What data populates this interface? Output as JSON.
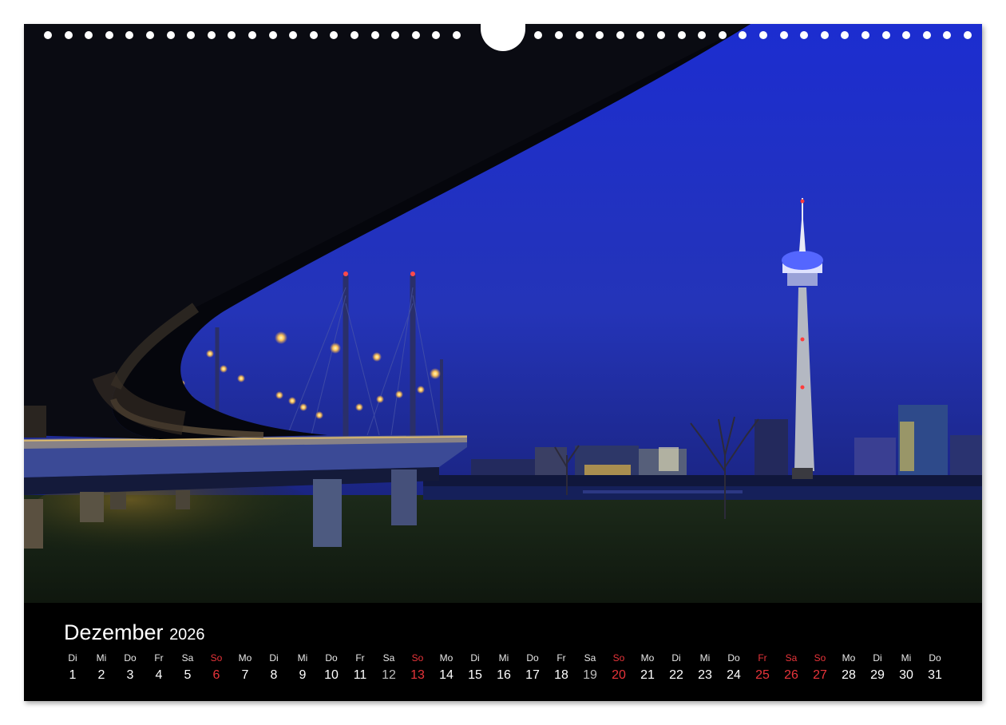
{
  "calendar": {
    "month": "Dezember",
    "year": "2026",
    "days": [
      {
        "wd": "Di",
        "num": "1",
        "type": "weekday"
      },
      {
        "wd": "Mi",
        "num": "2",
        "type": "weekday"
      },
      {
        "wd": "Do",
        "num": "3",
        "type": "weekday"
      },
      {
        "wd": "Fr",
        "num": "4",
        "type": "weekday"
      },
      {
        "wd": "Sa",
        "num": "5",
        "type": "weekday"
      },
      {
        "wd": "So",
        "num": "6",
        "type": "sun"
      },
      {
        "wd": "Mo",
        "num": "7",
        "type": "weekday"
      },
      {
        "wd": "Di",
        "num": "8",
        "type": "weekday"
      },
      {
        "wd": "Mi",
        "num": "9",
        "type": "weekday"
      },
      {
        "wd": "Do",
        "num": "10",
        "type": "weekday"
      },
      {
        "wd": "Fr",
        "num": "11",
        "type": "weekday"
      },
      {
        "wd": "Sa",
        "num": "12",
        "type": "sat"
      },
      {
        "wd": "So",
        "num": "13",
        "type": "sun"
      },
      {
        "wd": "Mo",
        "num": "14",
        "type": "weekday"
      },
      {
        "wd": "Di",
        "num": "15",
        "type": "weekday"
      },
      {
        "wd": "Mi",
        "num": "16",
        "type": "weekday"
      },
      {
        "wd": "Do",
        "num": "17",
        "type": "weekday"
      },
      {
        "wd": "Fr",
        "num": "18",
        "type": "weekday"
      },
      {
        "wd": "Sa",
        "num": "19",
        "type": "sat"
      },
      {
        "wd": "So",
        "num": "20",
        "type": "sun"
      },
      {
        "wd": "Mo",
        "num": "21",
        "type": "weekday"
      },
      {
        "wd": "Di",
        "num": "22",
        "type": "weekday"
      },
      {
        "wd": "Mi",
        "num": "23",
        "type": "weekday"
      },
      {
        "wd": "Do",
        "num": "24",
        "type": "weekday"
      },
      {
        "wd": "Fr",
        "num": "25",
        "type": "hol"
      },
      {
        "wd": "Sa",
        "num": "26",
        "type": "hol"
      },
      {
        "wd": "So",
        "num": "27",
        "type": "sun"
      },
      {
        "wd": "Mo",
        "num": "28",
        "type": "weekday"
      },
      {
        "wd": "Di",
        "num": "29",
        "type": "weekday"
      },
      {
        "wd": "Mi",
        "num": "30",
        "type": "weekday"
      },
      {
        "wd": "Do",
        "num": "31",
        "type": "weekday"
      }
    ]
  },
  "colors": {
    "sunday_holiday": "#e8343a",
    "saturday_number": "#bdbdbd",
    "sky": "#1f2fc4",
    "background": "#000000"
  },
  "photo": {
    "subject": "night-photo"
  }
}
